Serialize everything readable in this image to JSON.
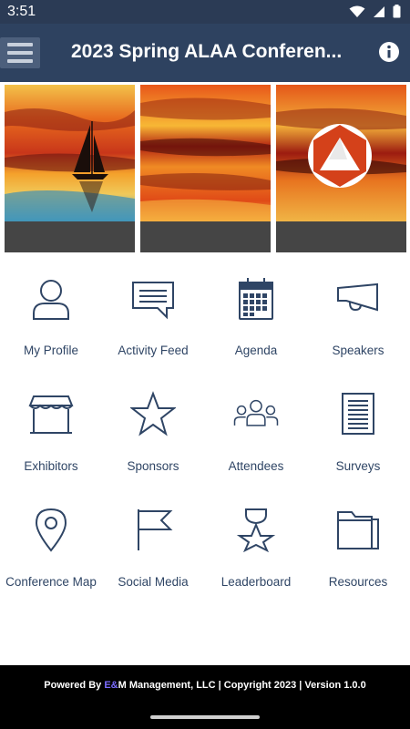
{
  "status": {
    "time": "3:51"
  },
  "header": {
    "title": "2023 Spring ALAA Conferen..."
  },
  "tiles": [
    {
      "label": "My Profile",
      "icon": "profile-icon"
    },
    {
      "label": "Activity Feed",
      "icon": "chat-bubble-icon"
    },
    {
      "label": "Agenda",
      "icon": "calendar-icon"
    },
    {
      "label": "Speakers",
      "icon": "megaphone-icon"
    },
    {
      "label": "Exhibitors",
      "icon": "storefront-icon"
    },
    {
      "label": "Sponsors",
      "icon": "star-icon"
    },
    {
      "label": "Attendees",
      "icon": "people-icon"
    },
    {
      "label": "Surveys",
      "icon": "document-icon"
    },
    {
      "label": "Conference Map",
      "icon": "map-pin-icon"
    },
    {
      "label": "Social Media",
      "icon": "flag-icon"
    },
    {
      "label": "Leaderboard",
      "icon": "medal-icon"
    },
    {
      "label": "Resources",
      "icon": "folder-icon"
    }
  ],
  "footer": {
    "prefix": "Powered By ",
    "brand_e": "E",
    "brand_amp": "&",
    "brand_m": "M",
    "suffix": " Management, LLC | Copyright 2023 | Version 1.0.0"
  },
  "colors": {
    "header": "#2e4260",
    "status_bar": "#2b3b55",
    "icon": "#2f4565",
    "footer": "#000000"
  }
}
